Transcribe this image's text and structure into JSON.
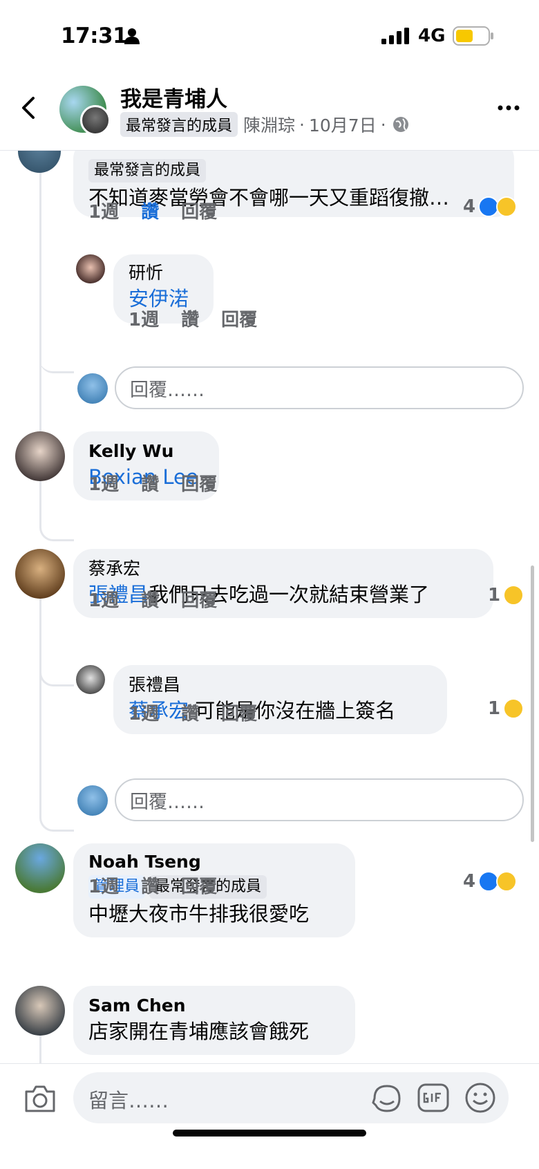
{
  "status_bar": {
    "time": "17:31",
    "network": "4G"
  },
  "header": {
    "group_name": "我是青埔人",
    "badge": "最常發言的成員",
    "author": "陳淵琮",
    "separator1": "·",
    "date": "10月7日",
    "separator2": "·"
  },
  "comments": [
    {
      "badge": "最常發言的成員",
      "text": "不知道麥當勞會不會哪一天又重蹈復撤…",
      "time": "1週",
      "like": "讚",
      "reply": "回覆",
      "reaction_count": "4",
      "reactions": [
        "like-icon",
        "haha-icon"
      ]
    },
    {
      "author": "研忻",
      "mention": "安伊渃",
      "time": "1週",
      "like": "讚",
      "reply": "回覆"
    },
    {
      "author": "Kelly Wu",
      "mention": "Boxian Lee",
      "time": "1週",
      "like": "讚",
      "reply": "回覆"
    },
    {
      "author": "蔡承宏",
      "mention": "張禮昌",
      "text": "我們只去吃過一次就結束營業了",
      "time": "1週",
      "like": "讚",
      "reply": "回覆",
      "reaction_count": "1",
      "reactions": [
        "haha-icon"
      ]
    },
    {
      "author": "張禮昌",
      "mention": "蔡承宏",
      "text": " 可能是你沒在牆上簽名",
      "time": "1週",
      "like": "讚",
      "reply": "回覆",
      "reaction_count": "1",
      "reactions": [
        "haha-icon"
      ]
    },
    {
      "author": "Noah Tseng",
      "badges": [
        "管理員",
        "最常發言的成員"
      ],
      "text": "中壢大夜市牛排我很愛吃",
      "time": "1週",
      "like": "讚",
      "reply": "回覆",
      "reaction_count": "4",
      "reactions": [
        "like-icon",
        "sad-icon"
      ]
    },
    {
      "author": "Sam Chen",
      "text": "店家開在青埔應該會餓死"
    }
  ],
  "reply_placeholder": "回覆……",
  "composer": {
    "placeholder": "留言……"
  },
  "colors": {
    "link_blue": "#1a6ed8",
    "bubble_bg": "#f0f2f5",
    "secondary_text": "#65676b"
  }
}
